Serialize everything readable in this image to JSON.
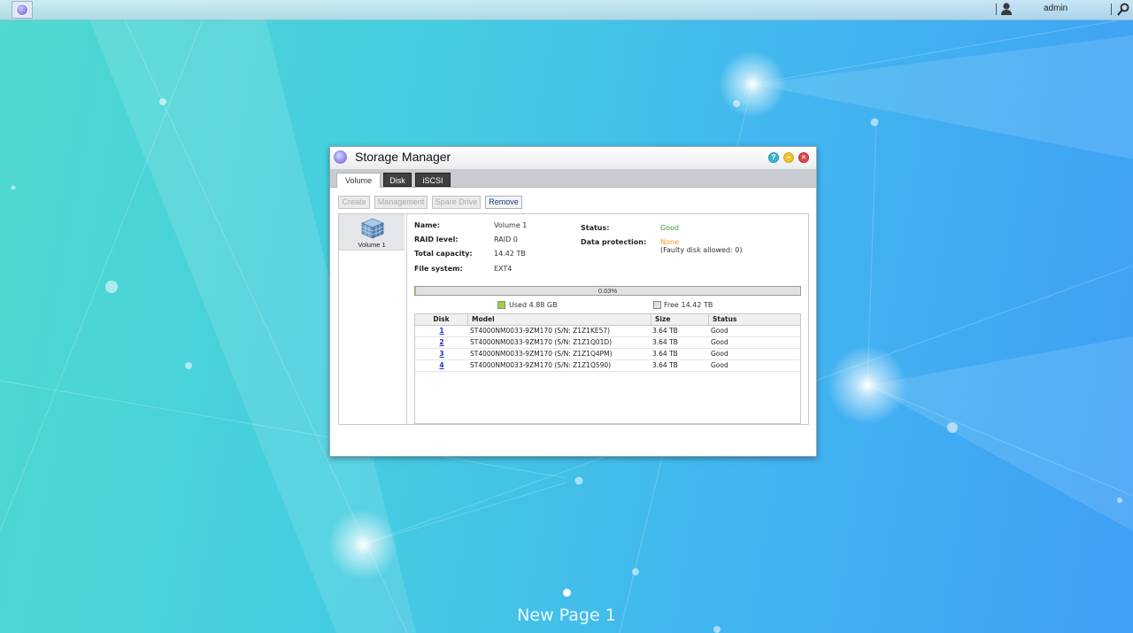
{
  "topbar": {
    "username": "admin"
  },
  "window": {
    "title": "Storage Manager",
    "help_glyph": "?",
    "tabs": [
      {
        "label": "Volume",
        "active": true
      },
      {
        "label": "Disk",
        "active": false
      },
      {
        "label": "iSCSI",
        "active": false
      }
    ],
    "toolbar": {
      "create": "Create",
      "management": "Management",
      "spare_drive": "Spare Drive",
      "remove": "Remove"
    }
  },
  "volumes": [
    {
      "label": "Volume 1"
    }
  ],
  "details": {
    "name_label": "Name:",
    "name_value": "Volume 1",
    "raid_label": "RAID level:",
    "raid_value": "RAID 0",
    "capacity_label": "Total capacity:",
    "capacity_value": "14.42 TB",
    "fs_label": "File system:",
    "fs_value": "EXT4",
    "status_label": "Status:",
    "status_value": "Good",
    "protection_label": "Data protection:",
    "protection_value": "None",
    "protection_note": "(Faulty disk allowed: 0)"
  },
  "usage": {
    "percent_text": "0.03%",
    "used_fraction": 0.0003,
    "used_label": "Used 4.88 GB",
    "free_label": "Free 14.42 TB",
    "used_color": "#9ed13c",
    "free_color": "#e1e1e1"
  },
  "disk_table": {
    "headers": [
      "Disk",
      "Model",
      "Size",
      "Status"
    ],
    "rows": [
      {
        "disk": "1",
        "model": "ST4000NM0033-9ZM170 (S/N: Z1Z1KE57)",
        "size": "3.64 TB",
        "status": "Good"
      },
      {
        "disk": "2",
        "model": "ST4000NM0033-9ZM170 (S/N: Z1Z1Q01D)",
        "size": "3.64 TB",
        "status": "Good"
      },
      {
        "disk": "3",
        "model": "ST4000NM0033-9ZM170 (S/N: Z1Z1Q4PM)",
        "size": "3.64 TB",
        "status": "Good"
      },
      {
        "disk": "4",
        "model": "ST4000NM0033-9ZM170 (S/N: Z1Z1Q590)",
        "size": "3.64 TB",
        "status": "Good"
      }
    ]
  },
  "desktop": {
    "page_label": "New Page 1"
  }
}
